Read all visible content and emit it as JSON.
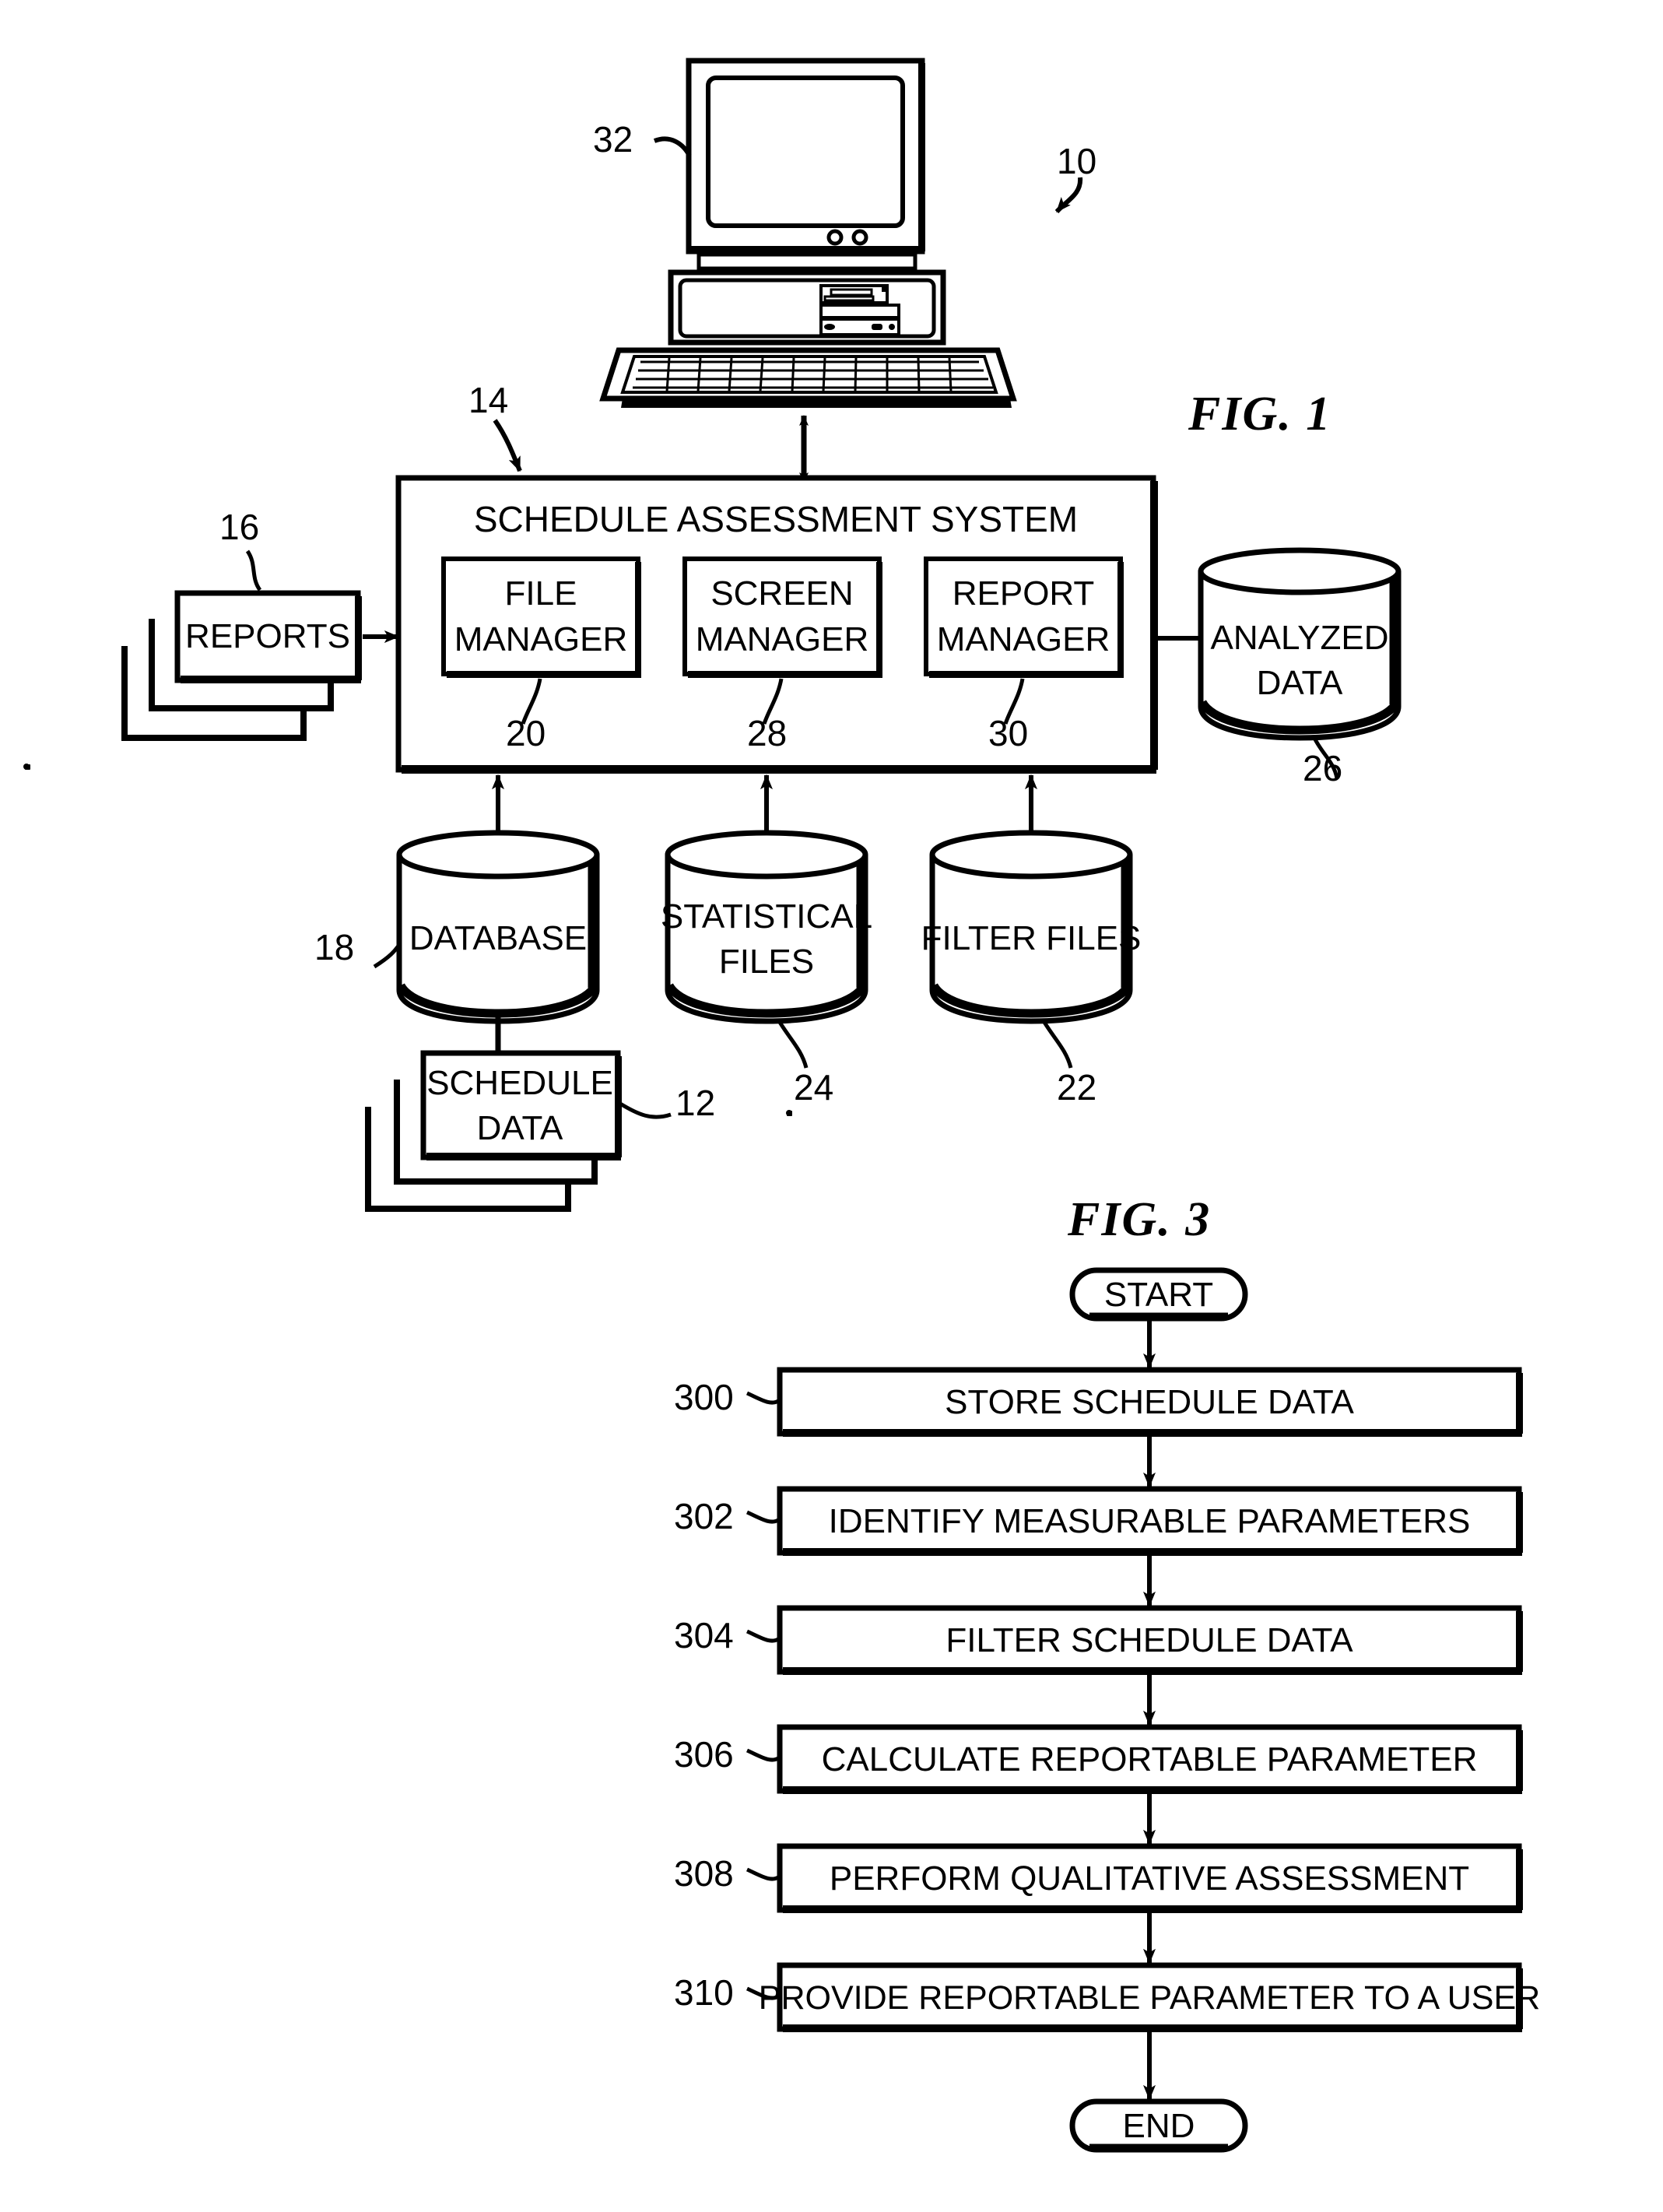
{
  "figures": [
    {
      "id": "fig1",
      "title": "FIG. 1"
    },
    {
      "id": "fig3",
      "title": "FIG. 3"
    }
  ],
  "fig1": {
    "title": "FIG. 1",
    "system_overall_ref": "10",
    "computer": {
      "ref": "32",
      "name": "desktop-computer"
    },
    "system_box": {
      "ref": "14",
      "title": "SCHEDULE ASSESSMENT SYSTEM",
      "modules": [
        {
          "label_line1": "FILE",
          "label_line2": "MANAGER",
          "ref": "20"
        },
        {
          "label_line1": "SCREEN",
          "label_line2": "MANAGER",
          "ref": "28"
        },
        {
          "label_line1": "REPORT",
          "label_line2": "MANAGER",
          "ref": "30"
        }
      ]
    },
    "reports": {
      "label": "REPORTS",
      "ref": "16"
    },
    "analyzed_data": {
      "label_line1": "ANALYZED",
      "label_line2": "DATA",
      "ref": "26"
    },
    "stores": [
      {
        "label_line1": "DATABASE",
        "label_line2": "",
        "ref": "18"
      },
      {
        "label_line1": "STATISTICAL",
        "label_line2": "FILES",
        "ref": "24"
      },
      {
        "label_line1": "FILTER FILES",
        "label_line2": "",
        "ref": "22"
      }
    ],
    "schedule_data": {
      "label_line1": "SCHEDULE",
      "label_line2": "DATA",
      "ref": "12"
    }
  },
  "fig3": {
    "title": "FIG. 3",
    "start_label": "START",
    "end_label": "END",
    "steps": [
      {
        "ref": "300",
        "label": "STORE SCHEDULE DATA"
      },
      {
        "ref": "302",
        "label": "IDENTIFY MEASURABLE PARAMETERS"
      },
      {
        "ref": "304",
        "label": "FILTER SCHEDULE DATA"
      },
      {
        "ref": "306",
        "label": "CALCULATE REPORTABLE PARAMETER"
      },
      {
        "ref": "308",
        "label": "PERFORM QUALITATIVE ASSESSMENT"
      },
      {
        "ref": "310",
        "label": "PROVIDE REPORTABLE PARAMETER TO A USER"
      }
    ]
  },
  "colors": {
    "ink": "#000000",
    "paper": "#ffffff"
  }
}
